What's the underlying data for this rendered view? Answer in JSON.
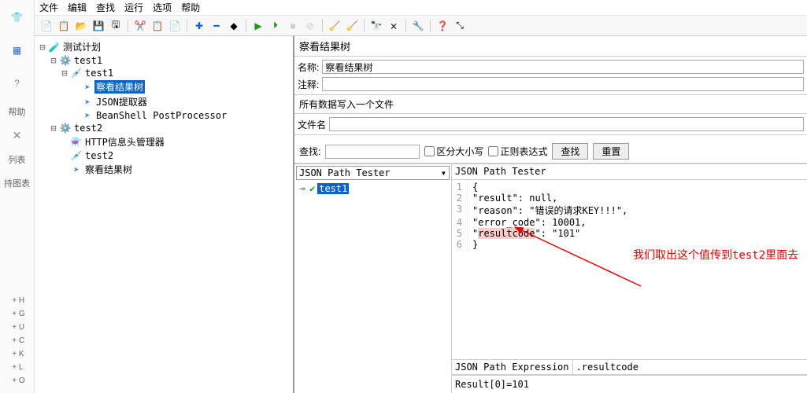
{
  "menu": {
    "items": [
      "文件",
      "编辑",
      "查找",
      "运行",
      "选项",
      "帮助"
    ]
  },
  "sidebar": {
    "help_label": "帮助",
    "list_label": "列表",
    "chart_label": "持图表"
  },
  "tree": {
    "root": "测试计划",
    "n1": "test1",
    "n1_1": "test1",
    "n1_1_1": "察看结果树",
    "n1_1_2": "JSON提取器",
    "n1_1_3": "BeanShell PostProcessor",
    "n2": "test2",
    "n2_1": "HTTP信息头管理器",
    "n2_2": "test2",
    "n2_3": "察看结果树"
  },
  "panel": {
    "title": "察看结果树",
    "name_label": "名称:",
    "name_value": "察看结果树",
    "comment_label": "注释:",
    "file_group": "所有数据写入一个文件",
    "filename_label": "文件名"
  },
  "search": {
    "label": "查找:",
    "case_label": "区分大小写",
    "regex_label": "正则表达式",
    "find_btn": "查找",
    "reset_btn": "重置"
  },
  "resultLeft": {
    "dropdown": "JSON Path Tester",
    "item1": "test1"
  },
  "resultRight": {
    "header": "JSON Path Tester",
    "line1": "{",
    "line2": "    \"result\": null,",
    "line3": "    \"reason\": \"错误的请求KEY!!!\",",
    "line4": "    \"error_code\": 10001,",
    "line5_a": "    \"",
    "line5_hl": "resultcode",
    "line5_b": "\": \"101\"",
    "line6": "}",
    "annotation": "我们取出这个值传到test2里面去"
  },
  "expr": {
    "label": "JSON Path Expression",
    "value": ".resultcode"
  },
  "output": "Result[0]=101",
  "shortcuts": [
    "+ H",
    "+ G",
    "+ U",
    "+ C",
    "+ K",
    "+ L",
    "+ O"
  ]
}
